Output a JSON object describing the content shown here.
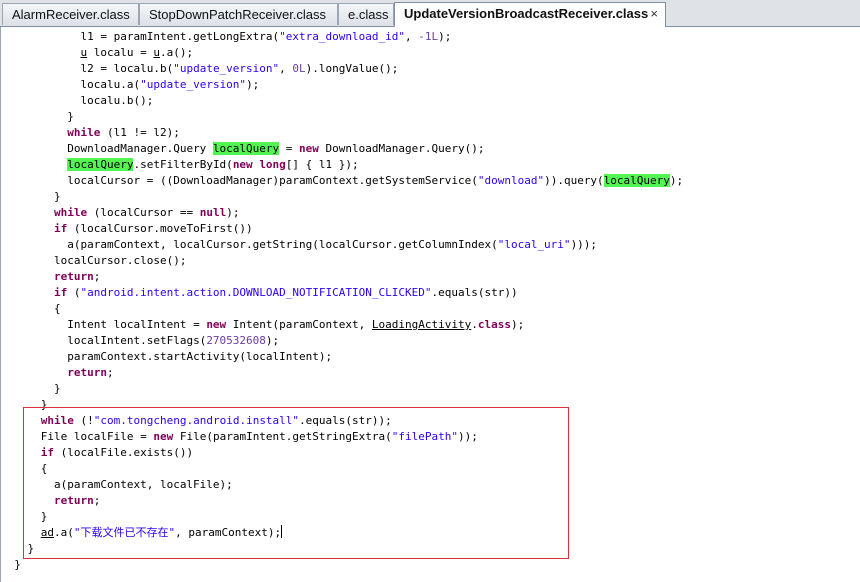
{
  "tabs": [
    {
      "label": "AlarmReceiver.class",
      "active": false
    },
    {
      "label": "StopDownPatchReceiver.class",
      "active": false
    },
    {
      "label": "e.class",
      "active": false
    },
    {
      "label": "UpdateVersionBroadcastReceiver.class",
      "active": true
    }
  ],
  "close_glyph": "×",
  "code": {
    "l0a": "l1 = paramIntent.getLongExtra(",
    "l0s": "\"extra_download_id\"",
    "l0b": ", ",
    "l0n": "-1L",
    "l0c": ");",
    "l1a": "u",
    "l1b": " localu = ",
    "l1c": "u",
    "l1d": ".a();",
    "l2a": "l2 = localu.b(",
    "l2s": "\"update_version\"",
    "l2b": ", ",
    "l2n": "0L",
    "l2c": ").longValue();",
    "l3a": "localu.a(",
    "l3s": "\"update_version\"",
    "l3c": ");",
    "l4": "localu.b();",
    "l5": "}",
    "l6k": "while",
    "l6": " (l1 != l2);",
    "l7a": "DownloadManager.Query ",
    "l7h": "localQuery",
    "l7b": " = ",
    "l7k": "new",
    "l7c": " DownloadManager.Query();",
    "l8h": "localQuery",
    "l8a": ".setFilterById(",
    "l8k1": "new",
    "l8b": " ",
    "l8k2": "long",
    "l8c": "[] { l1 });",
    "l9a": "localCursor = ((DownloadManager)paramContext.getSystemService(",
    "l9s": "\"download\"",
    "l9b": ")).query(",
    "l9h": "localQuery",
    "l9c": ");",
    "l10": "}",
    "l11k": "while",
    "l11a": " (localCursor == ",
    "l11k2": "null",
    "l11b": ");",
    "l12k": "if",
    "l12": " (localCursor.moveToFirst())",
    "l13a": "a(paramContext, localCursor.getString(localCursor.getColumnIndex(",
    "l13s": "\"local_uri\"",
    "l13b": ")));",
    "l14": "localCursor.close();",
    "l15k": "return",
    "l15": ";",
    "l16k": "if",
    "l16a": " (",
    "l16s": "\"android.intent.action.DOWNLOAD_NOTIFICATION_CLICKED\"",
    "l16b": ".equals(str))",
    "l17": "{",
    "l18a": "Intent localIntent = ",
    "l18k": "new",
    "l18b": " Intent(paramContext, ",
    "l18u": "LoadingActivity",
    "l18c": ".",
    "l18k2": "class",
    "l18d": ");",
    "l19a": "localIntent.setFlags(",
    "l19n": "270532608",
    "l19b": ");",
    "l20": "paramContext.startActivity(localIntent);",
    "l21k": "return",
    "l21": ";",
    "l22": "}",
    "l23": "}",
    "l24k": "while",
    "l24a": " (!",
    "l24s": "\"com.tongcheng.android.install\"",
    "l24b": ".equals(str));",
    "l25a": "File localFile = ",
    "l25k": "new",
    "l25b": " File(paramIntent.getStringExtra(",
    "l25s": "\"filePath\"",
    "l25c": "));",
    "l26k": "if",
    "l26": " (localFile.exists())",
    "l27": "{",
    "l28": "a(paramContext, localFile);",
    "l29k": "return",
    "l29": ";",
    "l30": "}",
    "l31u": "ad",
    "l31a": ".a(",
    "l31s": "\"下载文件已不存在\"",
    "l31b": ", paramContext);",
    "l32": "}",
    "l33": "}"
  }
}
